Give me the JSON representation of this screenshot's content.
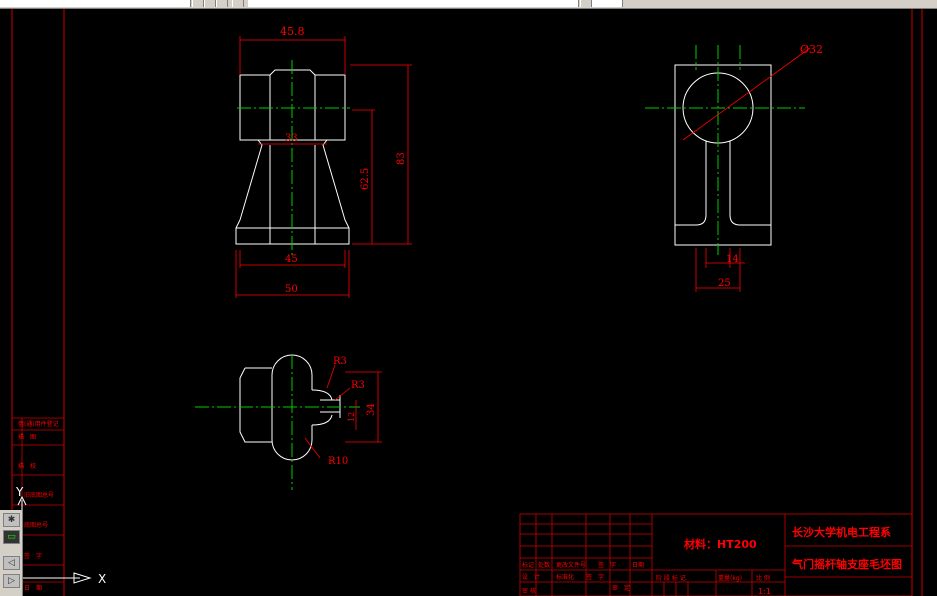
{
  "toolbar": {
    "field_value": ""
  },
  "views": {
    "front": {
      "dim_top": "45.8",
      "dim_mid": "33",
      "dim_height_inner": "62.5",
      "dim_height_total": "83",
      "dim_base": "45",
      "dim_bottom": "50"
    },
    "side": {
      "dim_diameter": "Ø32",
      "dim_14": "14",
      "dim_25": "25"
    },
    "top": {
      "r3a": "R3",
      "r3b": "R3",
      "dim_34": "34",
      "dim_12": "12",
      "r10": "R10"
    }
  },
  "title_block": {
    "school": "长沙大学机电工程系",
    "drawing_name": "气门摇杆轴支座毛坯图",
    "material": "材料：HT200",
    "scale": "1:1",
    "row1": [
      "标记",
      "处数",
      "更改文件号",
      "签　字",
      "日期"
    ],
    "row2": [
      "设　计",
      "",
      "标准化",
      "",
      "审　定"
    ],
    "row2b": [
      "签　字"
    ],
    "row3": [
      "阶 段 标 记",
      "重量(kg)",
      "比 例"
    ],
    "row4": [
      "审 核"
    ]
  },
  "left_block": [
    "借(通)用件登记",
    "描　图",
    "描　校",
    "旧底图总号",
    "底图总号",
    "签　字",
    "日　期"
  ],
  "ucs": {
    "y": "Y",
    "x": "X"
  },
  "colors": {
    "outline": "#ffffff",
    "dimension": "#ff0000",
    "center": "#00cc00",
    "border": "#cc0000"
  }
}
